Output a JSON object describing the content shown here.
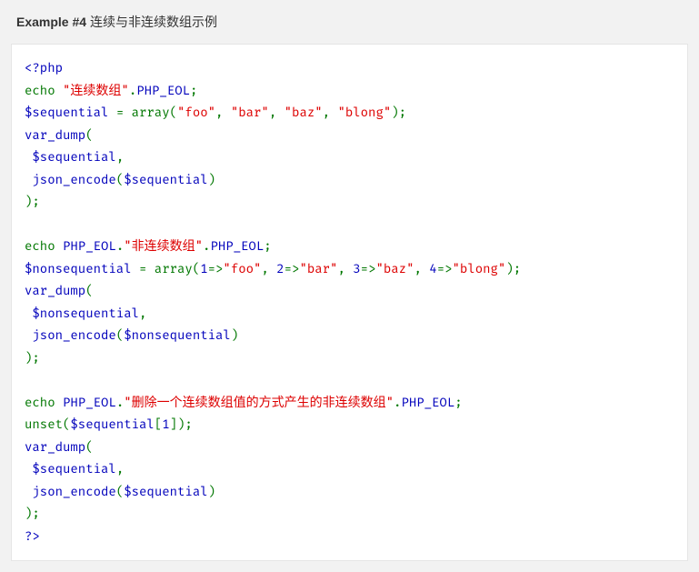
{
  "header": {
    "example_label": "Example #4",
    "title": "连续与非连续数组示例"
  },
  "code": {
    "l1": {
      "a": "<?php"
    },
    "l2": {
      "a": "echo ",
      "b": "\"连续数组\"",
      "c": ".",
      "d": "PHP_EOL",
      "e": ";"
    },
    "l3": {
      "a": "$sequential ",
      "b": "= array(",
      "c": "\"foo\"",
      "d": ", ",
      "e": "\"bar\"",
      "f": ", ",
      "g": "\"baz\"",
      "h": ", ",
      "i": "\"blong\"",
      "j": ");"
    },
    "l4": {
      "a": "var_dump",
      "b": "("
    },
    "l5": {
      "a": " $sequential",
      "b": ","
    },
    "l6": {
      "a": " json_encode",
      "b": "(",
      "c": "$sequential",
      "d": ")"
    },
    "l7": {
      "a": ");"
    },
    "blank1": "",
    "l8": {
      "a": "echo ",
      "b": "PHP_EOL",
      "c": ".",
      "d": "\"非连续数组\"",
      "e": ".",
      "f": "PHP_EOL",
      "g": ";"
    },
    "l9": {
      "a": "$nonsequential ",
      "b": "= array(",
      "c": "1",
      "d": "=>",
      "e": "\"foo\"",
      "f": ", ",
      "g": "2",
      "h": "=>",
      "i": "\"bar\"",
      "j": ", ",
      "k": "3",
      "l": "=>",
      "m": "\"baz\"",
      "n": ", ",
      "o": "4",
      "p": "=>",
      "q": "\"blong\"",
      "r": ");"
    },
    "l10": {
      "a": "var_dump",
      "b": "("
    },
    "l11": {
      "a": " $nonsequential",
      "b": ","
    },
    "l12": {
      "a": " json_encode",
      "b": "(",
      "c": "$nonsequential",
      "d": ")"
    },
    "l13": {
      "a": ");"
    },
    "blank2": "",
    "l14": {
      "a": "echo ",
      "b": "PHP_EOL",
      "c": ".",
      "d": "\"删除一个连续数组值的方式产生的非连续数组\"",
      "e": ".",
      "f": "PHP_EOL",
      "g": ";"
    },
    "l15": {
      "a": "unset(",
      "b": "$sequential",
      "c": "[",
      "d": "1",
      "e": "]);"
    },
    "l16": {
      "a": "var_dump",
      "b": "("
    },
    "l17": {
      "a": " $sequential",
      "b": ","
    },
    "l18": {
      "a": " json_encode",
      "b": "(",
      "c": "$sequential",
      "d": ")"
    },
    "l19": {
      "a": ");"
    },
    "l20": {
      "a": "?>"
    }
  }
}
